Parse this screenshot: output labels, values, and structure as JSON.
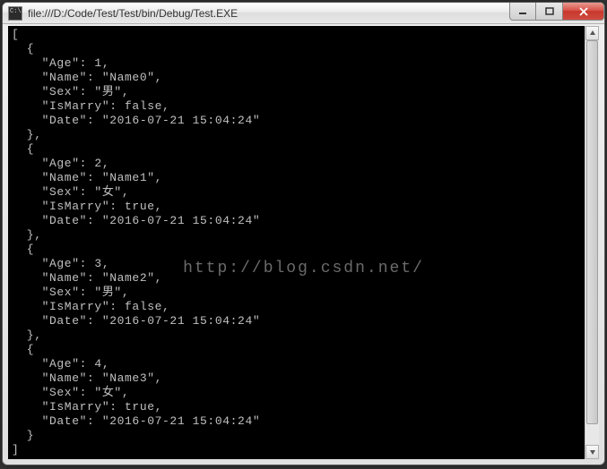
{
  "window": {
    "title": "file:///D:/Code/Test/Test/bin/Debug/Test.EXE"
  },
  "console_output": {
    "records": [
      {
        "Age": 1,
        "Name": "Name0",
        "Sex": "男",
        "IsMarry": false,
        "Date": "2016-07-21 15:04:24"
      },
      {
        "Age": 2,
        "Name": "Name1",
        "Sex": "女",
        "IsMarry": true,
        "Date": "2016-07-21 15:04:24"
      },
      {
        "Age": 3,
        "Name": "Name2",
        "Sex": "男",
        "IsMarry": false,
        "Date": "2016-07-21 15:04:24"
      },
      {
        "Age": 4,
        "Name": "Name3",
        "Sex": "女",
        "IsMarry": true,
        "Date": "2016-07-21 15:04:24"
      }
    ]
  },
  "watermark": "http://blog.csdn.net/"
}
